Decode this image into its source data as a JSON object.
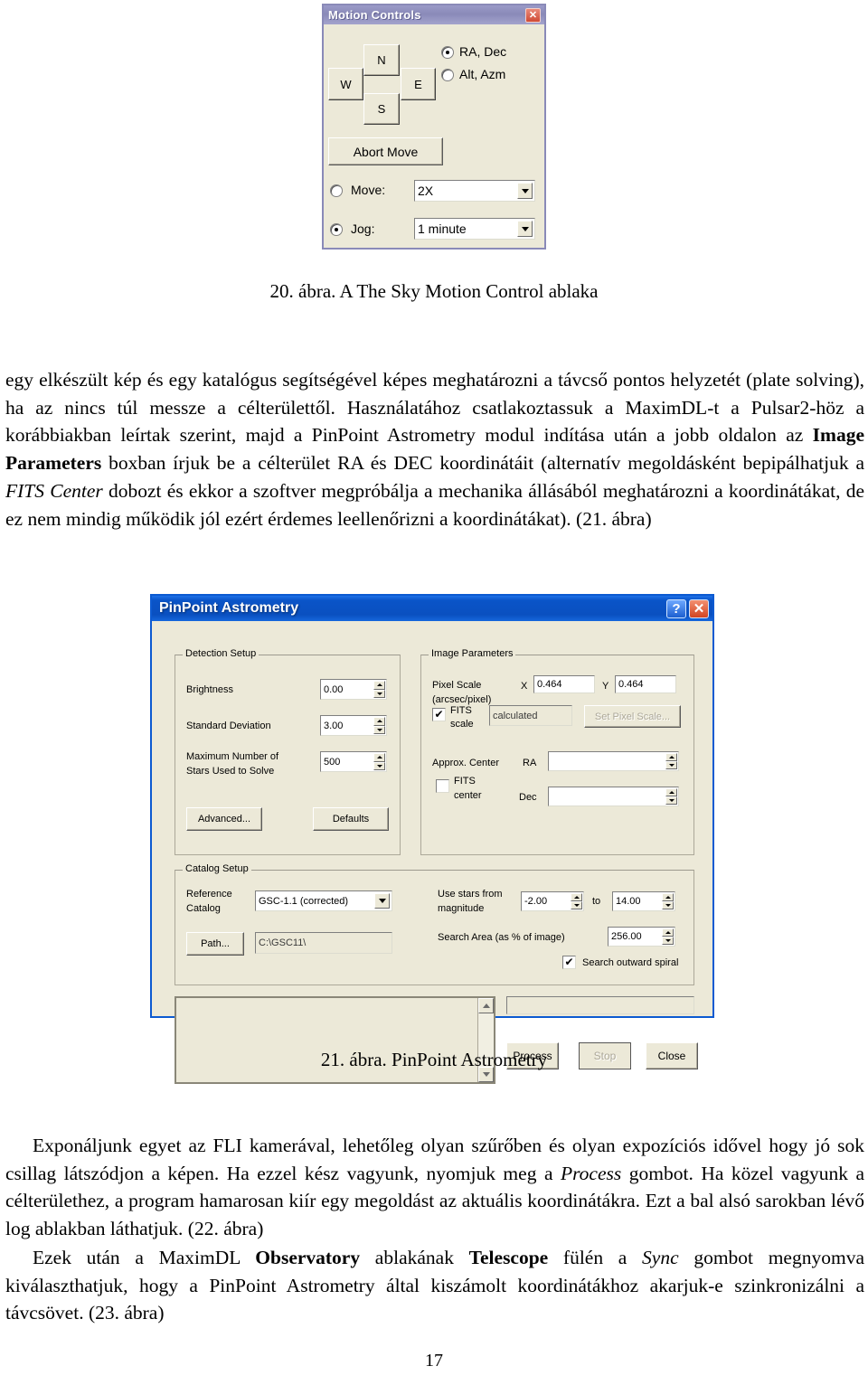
{
  "motion_controls": {
    "title": "Motion Controls",
    "close_label": "✕",
    "direction_buttons": {
      "north": "N",
      "south": "S",
      "east": "E",
      "west": "W"
    },
    "abort_label": "Abort Move",
    "coord_mode": [
      {
        "label": "RA, Dec",
        "selected": true
      },
      {
        "label": "Alt, Azm",
        "selected": false
      }
    ],
    "move": {
      "label": "Move:",
      "value": "2X",
      "selected": false
    },
    "jog": {
      "label": "Jog:",
      "value": "1 minute",
      "selected": true
    }
  },
  "figure20_caption": "20. ábra. A The Sky Motion Control ablaka",
  "paragraph1": "egy elkészült kép és egy katalógus segítségével képes meghatározni a távcső pontos helyzetét (plate solving), ha az nincs túl messze a célterülettől. Használatához csatlakoztassuk a ",
  "paragraph1_b": "MaximDL-t a Pulsar2-höz a korábbiakban leírtak szerint, majd a PinPoint Astrometry modul indítása után a jobb oldalon az ",
  "paragraph1_bold1": "Image Parameters",
  "paragraph1_c": " boxban írjuk be a célterület RA és DEC koordinátáit (alternatív megoldásként bepipálhatjuk a ",
  "paragraph1_italic1": "FITS Center",
  "paragraph1_d": " dobozt és ekkor a szoftver megpróbálja a mechanika állásából meghatározni a koordinátákat, de ez nem mindig működik jól ezért érdemes leellenőrizni a koordinátákat). (21. ábra)",
  "pinpoint": {
    "title": "PinPoint Astrometry",
    "help_label": "?",
    "close_label": "✕",
    "detection_setup": {
      "legend": "Detection Setup",
      "brightness_label": "Brightness",
      "brightness_value": "0.00",
      "stddev_label": "Standard Deviation",
      "stddev_value": "3.00",
      "maxstars_label_line1": "Maximum Number of",
      "maxstars_label_line2": "Stars Used to Solve",
      "maxstars_value": "500",
      "advanced_label": "Advanced...",
      "defaults_label": "Defaults"
    },
    "image_parameters": {
      "legend": "Image Parameters",
      "pixel_scale_label_line1": "Pixel Scale",
      "pixel_scale_label_line2": "(arcsec/pixel)",
      "x_label": "X",
      "x_value": "0.464",
      "y_label": "Y",
      "y_value": "0.464",
      "fits_scale_line1": "FITS",
      "fits_scale_line2": "scale",
      "fits_scale_checked": true,
      "calculated_value": "calculated",
      "set_pixel_scale_label": "Set Pixel Scale...",
      "approx_center_label": "Approx. Center",
      "fits_center_line1": "FITS",
      "fits_center_line2": "center",
      "fits_center_checked": false,
      "ra_label": "RA",
      "ra_value": "",
      "dec_label": "Dec",
      "dec_value": ""
    },
    "catalog_setup": {
      "legend": "Catalog Setup",
      "reference_catalog_line1": "Reference",
      "reference_catalog_line2": "Catalog",
      "reference_catalog_value": "GSC-1.1 (corrected)",
      "path_button_label": "Path...",
      "path_value": "C:\\GSC11\\",
      "use_stars_line1": "Use stars from",
      "use_stars_line2": "magnitude",
      "mag_from": "-2.00",
      "to_label": "to",
      "mag_to": "14.00",
      "search_area_label": "Search Area (as % of image)",
      "search_area_value": "256.00",
      "search_spiral_label": "Search outward spiral",
      "search_spiral_checked": true
    },
    "log_value": "",
    "status_value": "",
    "process_label": "Process",
    "stop_label": "Stop",
    "close_btn_label": "Close"
  },
  "figure21_caption": "21. ábra. PinPoint Astrometry",
  "paragraph2_a": "Exponáljunk egyet az FLI kamerával, lehetőleg olyan szűrőben és olyan expozíciós idővel hogy jó sok csillag látszódjon a képen. Ha ezzel kész vagyunk, nyomjuk meg a ",
  "paragraph2_italic": "Process",
  "paragraph2_b": " gombot. Ha közel vagyunk a célterülethez, a program hamarosan kiír egy megoldást az aktuális koordinátákra. Ezt a bal alsó sarokban lévő log ablakban láthatjuk. (22. ábra)",
  "paragraph3_a": "Ezek után a MaximDL ",
  "paragraph3_bold1": "Observatory",
  "paragraph3_b": " ablakának ",
  "paragraph3_bold2": "Telescope",
  "paragraph3_c": " fülén a ",
  "paragraph3_italic": "Sync",
  "paragraph3_d": " gombot megnyomva kiválaszthatjuk, hogy a PinPoint Astrometry által kiszámolt koordinátákhoz akarjuk-e szinkronizálni a távcsövet. (23. ábra)",
  "page_number": "17",
  "colors": {
    "window_face": "#ece9d8",
    "pinpoint_titlebar": "#0a54c8",
    "motion_titlebar": "#8a8ab8",
    "close_red": "#d14422"
  }
}
